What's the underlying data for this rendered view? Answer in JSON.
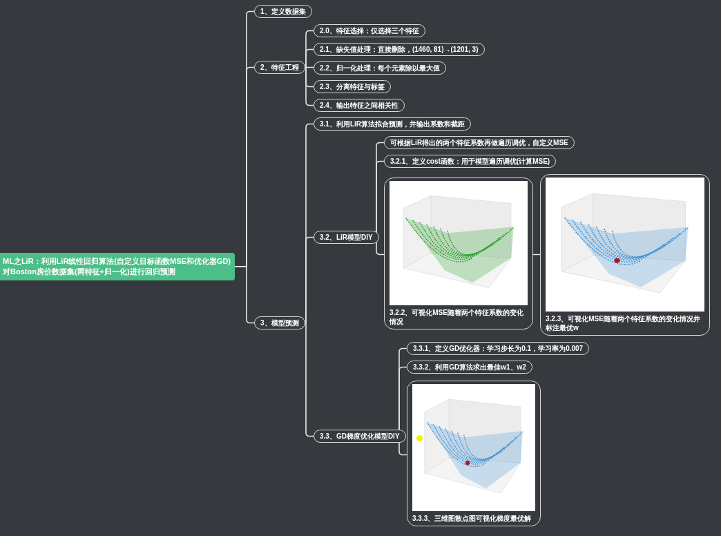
{
  "root": {
    "lines": [
      "ML之LiR：利用LiR线性回归算法(自定义目标函数MSE和优化器GD)",
      "对Boston房价数据集(两特征+归一化)进行回归预测"
    ]
  },
  "topics": [
    {
      "kind": "topic",
      "label": "1、定义数据集"
    },
    {
      "kind": "topic",
      "label": "2、特征工程",
      "children": [
        {
          "kind": "topic",
          "label": "2.0、特征选择：仅选择三个特征"
        },
        {
          "kind": "topic",
          "label": "2.1、缺失值处理：直接删除，(1460, 81)→(1201, 3)"
        },
        {
          "kind": "topic",
          "label": "2.2、归一化处理：每个元素除以最大值"
        },
        {
          "kind": "topic",
          "label": "2.3、分离特征与标签"
        },
        {
          "kind": "topic",
          "label": "2.4、输出特征之间相关性"
        }
      ]
    },
    {
      "kind": "topic",
      "label": "3、模型预测",
      "children": [
        {
          "kind": "topic",
          "label": "3.1、利用LiR算法拟合预测，并输出系数和截距"
        },
        {
          "kind": "topic",
          "label": "3.2、LiR模型DIY",
          "children": [
            {
              "kind": "topic",
              "label": "可根据LiR得出的两个特征系数再做遍历调优，自定义MSE"
            },
            {
              "kind": "topic",
              "label": "3.2.1、定义cost函数：用于模型遍历调优(计算MSE)"
            },
            {
              "caption": "3.2.2、可视化MSE随着两个特征系数的变化情况",
              "children": [
                {
                  "caption": "3.2.3、可视化MSE随着两个特征系数的变化情况并标注最优w"
                }
              ]
            }
          ]
        },
        {
          "kind": "topic",
          "label": "3.3、GD梯度优化模型DIY",
          "children": [
            {
              "kind": "topic",
              "label": "3.3.1、定义GD优化器：学习步长为0.1，学习率为0.007"
            },
            {
              "kind": "topic",
              "label": "3.3.2、利用GD算法求出最佳w1、w2"
            },
            {
              "caption": "3.3.3、三维图散点图可视化梯度最优解"
            }
          ]
        }
      ]
    }
  ]
}
